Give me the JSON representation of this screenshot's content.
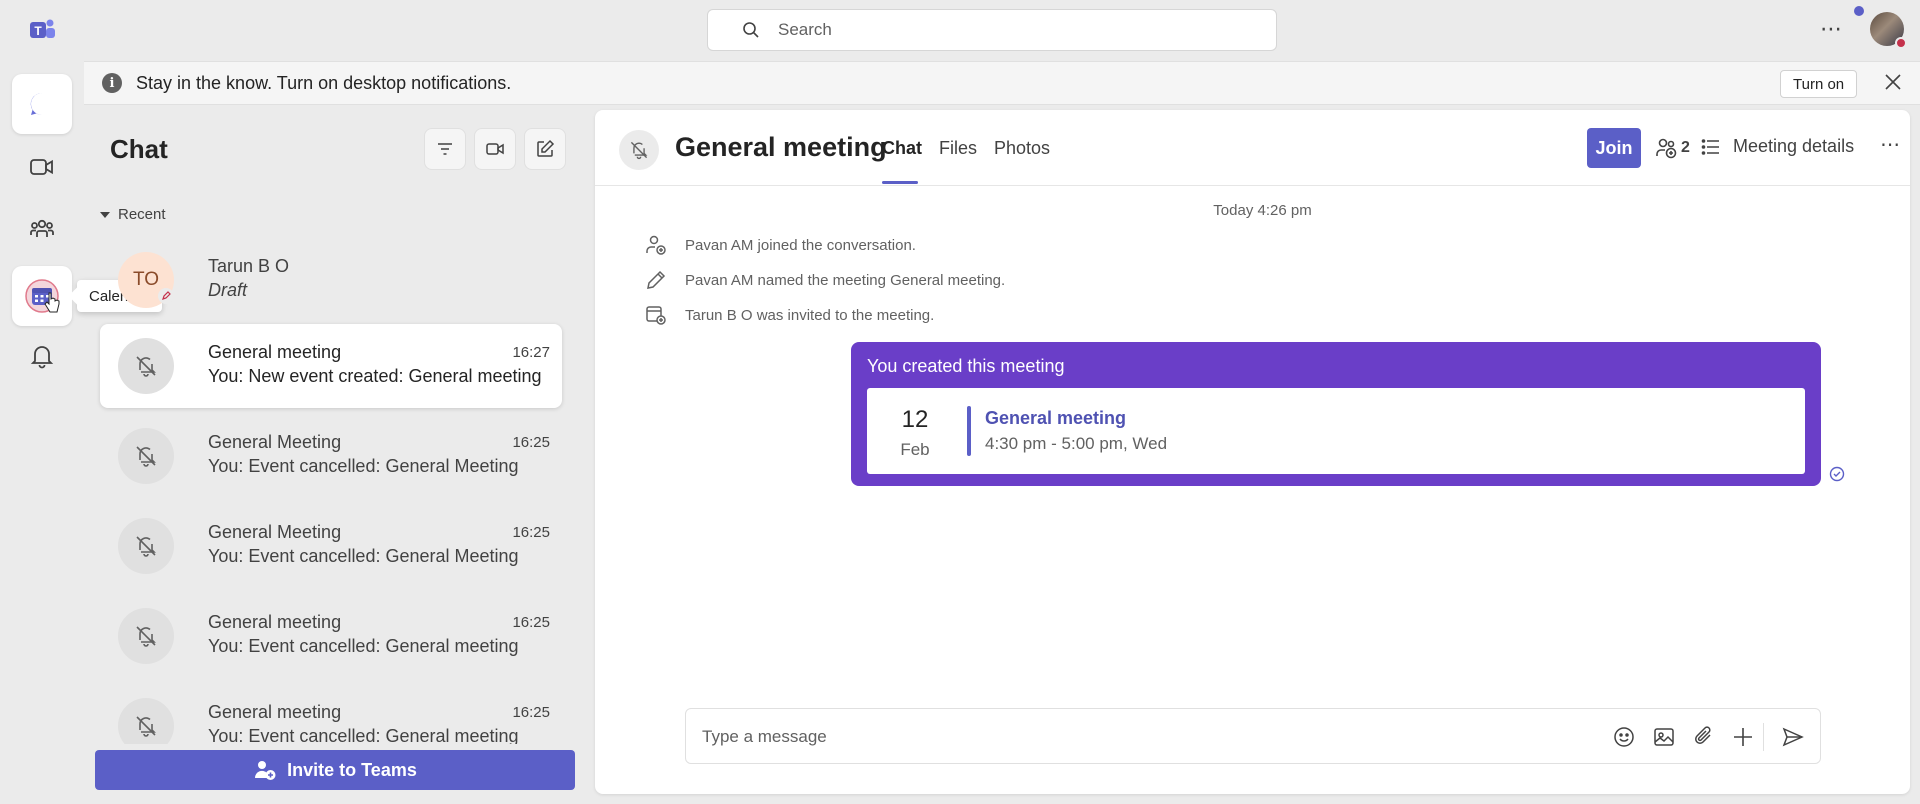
{
  "rail": {
    "tooltip": "Calendar",
    "items": [
      "chat",
      "meet",
      "teams",
      "calendar",
      "activity"
    ]
  },
  "topbar": {
    "search_placeholder": "Search",
    "more_label": "⋯"
  },
  "banner": {
    "message": "Stay in the know. Turn on desktop notifications.",
    "turn_on_label": "Turn on"
  },
  "chatlist": {
    "title": "Chat",
    "recent_label": "Recent",
    "items": [
      {
        "name": "Tarun B O",
        "initials": "TO",
        "preview": "Draft",
        "time": ""
      },
      {
        "name": "General meeting",
        "preview": "You: New event created: General meeting",
        "time": "16:27"
      },
      {
        "name": "General Meeting",
        "preview": "You: Event cancelled: General Meeting",
        "time": "16:25"
      },
      {
        "name": "General Meeting",
        "preview": "You: Event cancelled: General Meeting",
        "time": "16:25"
      },
      {
        "name": "General meeting",
        "preview": "You: Event cancelled: General meeting",
        "time": "16:25"
      },
      {
        "name": "General meeting",
        "preview": "You: Event cancelled: General meeting",
        "time": "16:25"
      }
    ],
    "invite_label": "Invite to Teams"
  },
  "conversation": {
    "title": "General meeting",
    "tabs": [
      "Chat",
      "Files",
      "Photos"
    ],
    "join_label": "Join",
    "participants_count": "2",
    "details_label": "Meeting details",
    "timestamp": "Today 4:26 pm",
    "system_messages": [
      "Pavan AM joined the conversation.",
      "Pavan AM named the meeting General meeting.",
      "Tarun B O was invited to the meeting."
    ],
    "card": {
      "header": "You created this meeting",
      "day": "12",
      "month": "Feb",
      "event_name": "General meeting",
      "event_time": "4:30 pm - 5:00 pm, Wed"
    },
    "composer_placeholder": "Type a message"
  },
  "colors": {
    "brand": "#5b5fc7",
    "card": "#6a3ec8"
  }
}
